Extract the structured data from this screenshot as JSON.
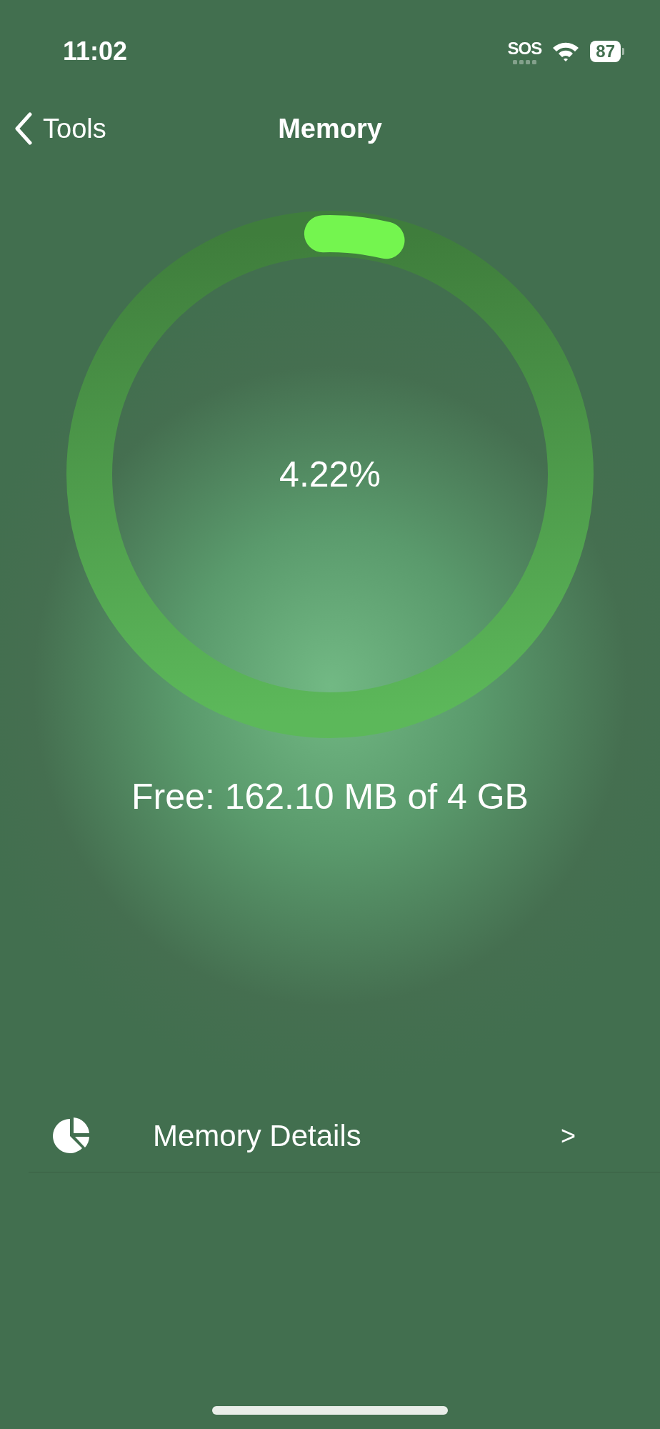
{
  "status_bar": {
    "time": "11:02",
    "carrier": "SOS",
    "battery": "87"
  },
  "nav": {
    "back_label": "Tools",
    "title": "Memory"
  },
  "gauge": {
    "reading": "4.22%"
  },
  "summary": "Free: 162.10 MB of 4 GB",
  "rows": [
    {
      "label": "Memory Details",
      "chevron": ">"
    }
  ]
}
